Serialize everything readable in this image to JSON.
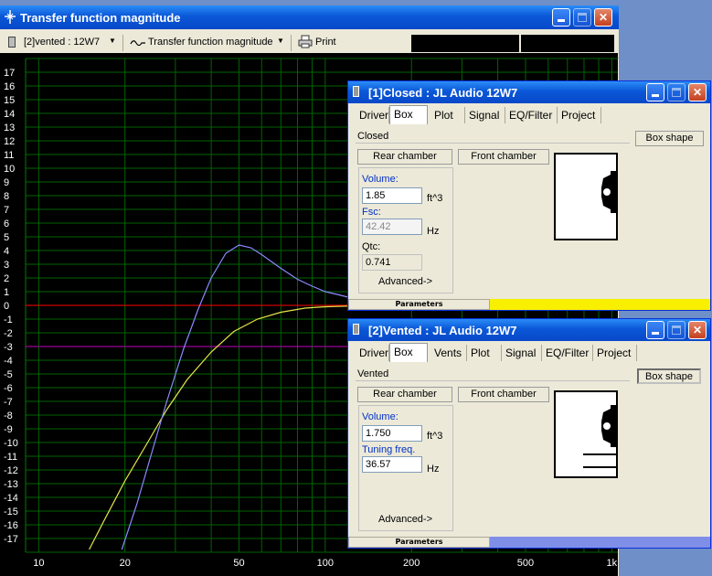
{
  "main": {
    "title": "Transfer function magnitude",
    "toolbar": {
      "project_select": "[2]vented : 12W7",
      "view_select": "Transfer function magnitude",
      "print_label": "Print"
    }
  },
  "chart_data": {
    "type": "line",
    "title": "",
    "xscale": "log",
    "xlim": [
      9,
      1050
    ],
    "ylim": [
      -18,
      18
    ],
    "x_ticks": [
      "10",
      "20",
      "50",
      "100",
      "200",
      "500",
      "1k"
    ],
    "y_ticks": [
      "17",
      "16",
      "15",
      "14",
      "13",
      "12",
      "11",
      "10",
      "9",
      "8",
      "7",
      "6",
      "5",
      "4",
      "3",
      "2",
      "1",
      "0",
      "-1",
      "-2",
      "-3",
      "-4",
      "-5",
      "-6",
      "-7",
      "-8",
      "-9",
      "-10",
      "-11",
      "-12",
      "-13",
      "-14",
      "-15",
      "-16",
      "-17"
    ],
    "reference_lines": [
      {
        "y": 0,
        "color": "#ff0000"
      },
      {
        "y": -3,
        "color": "#c000c0"
      }
    ],
    "grid": true,
    "series": [
      {
        "color": "#e6e64a",
        "x": [
          15,
          17,
          20,
          24,
          28,
          33,
          40,
          48,
          58,
          70,
          85,
          100,
          120,
          150,
          200
        ],
        "y": [
          -17.8,
          -15.6,
          -12.8,
          -10.0,
          -7.6,
          -5.4,
          -3.4,
          -1.9,
          -1.0,
          -0.5,
          -0.2,
          -0.1,
          -0.05,
          0,
          0
        ]
      },
      {
        "color": "#8a8aff",
        "x": [
          19.5,
          22,
          25,
          28,
          32,
          36,
          40,
          45,
          50,
          55,
          60,
          70,
          80,
          90,
          100,
          110,
          120,
          140,
          170
        ],
        "y": [
          -17.8,
          -14.5,
          -10.5,
          -7.0,
          -3.2,
          -0.3,
          2.0,
          3.8,
          4.4,
          4.2,
          3.7,
          2.7,
          1.9,
          1.4,
          1.0,
          0.8,
          0.6,
          0.4,
          0.2
        ]
      }
    ]
  },
  "closed_win": {
    "title": "[1]Closed : JL Audio 12W7",
    "tabs": [
      "Driver",
      "Box",
      "Plot",
      "Signal",
      "EQ/Filter",
      "Project"
    ],
    "box_type": "Closed",
    "box_shape_label": "Box shape",
    "rear_label": "Rear chamber",
    "front_label": "Front chamber",
    "volume_label": "Volume:",
    "volume_value": "1.85",
    "volume_unit": "ft^3",
    "fsc_label": "Fsc:",
    "fsc_value": "42.42",
    "fsc_unit": "Hz",
    "qtc_label": "Qtc:",
    "qtc_value": "0.741",
    "advanced_label": "Advanced->",
    "status_label": "Parameters",
    "status_color": "#f8f000"
  },
  "vented_win": {
    "title": "[2]Vented : JL Audio 12W7",
    "tabs": [
      "Driver",
      "Box",
      "Vents",
      "Plot",
      "Signal",
      "EQ/Filter",
      "Project"
    ],
    "box_type": "Vented",
    "box_shape_label": "Box shape",
    "rear_label": "Rear chamber",
    "front_label": "Front chamber",
    "volume_label": "Volume:",
    "volume_value": "1.750",
    "volume_unit": "ft^3",
    "tuning_label": "Tuning freq.",
    "tuning_value": "36.57",
    "tuning_unit": "Hz",
    "advanced_label": "Advanced->",
    "status_label": "Parameters",
    "status_color": "#7f8fe8"
  }
}
